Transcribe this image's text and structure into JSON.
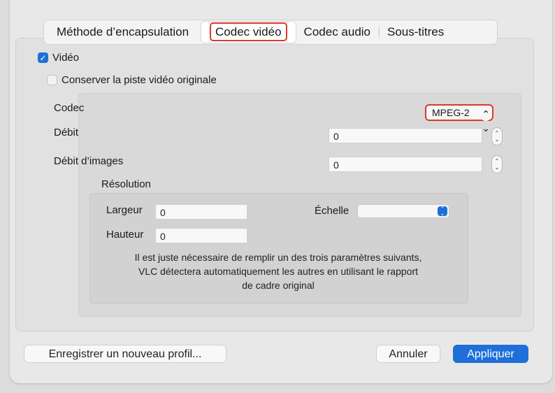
{
  "tabs": [
    {
      "label": "Méthode d’encapsulation",
      "active": false
    },
    {
      "label": "Codec vidéo",
      "active": true
    },
    {
      "label": "Codec audio",
      "active": false
    },
    {
      "label": "Sous-titres",
      "active": false
    }
  ],
  "video": {
    "checkbox_label": "Vidéo",
    "checked": true,
    "keep_original_label": "Conserver la piste vidéo originale",
    "keep_original_checked": false
  },
  "settings": {
    "codec_label": "Codec",
    "codec_value": "MPEG-2",
    "bitrate_label": "Débit",
    "bitrate_value": "0",
    "framerate_label": "Débit d’images",
    "framerate_value": "0"
  },
  "resolution": {
    "title": "Résolution",
    "width_label": "Largeur",
    "width_value": "0",
    "height_label": "Hauteur",
    "height_value": "0",
    "scale_label": "Échelle",
    "scale_value": "",
    "note": "Il est juste nécessaire de remplir un des trois paramètres suivants,\nVLC détectera automatiquement les autres en utilisant le rapport\nde cadre original"
  },
  "buttons": {
    "save_profile": "Enregistrer un nouveau profil...",
    "cancel": "Annuler",
    "apply": "Appliquer"
  },
  "colors": {
    "accent": "#1e6fd9",
    "highlight": "#d93b2b"
  },
  "icons": {
    "checkmark": "✓",
    "popup_arrows": "⌃⌄"
  }
}
